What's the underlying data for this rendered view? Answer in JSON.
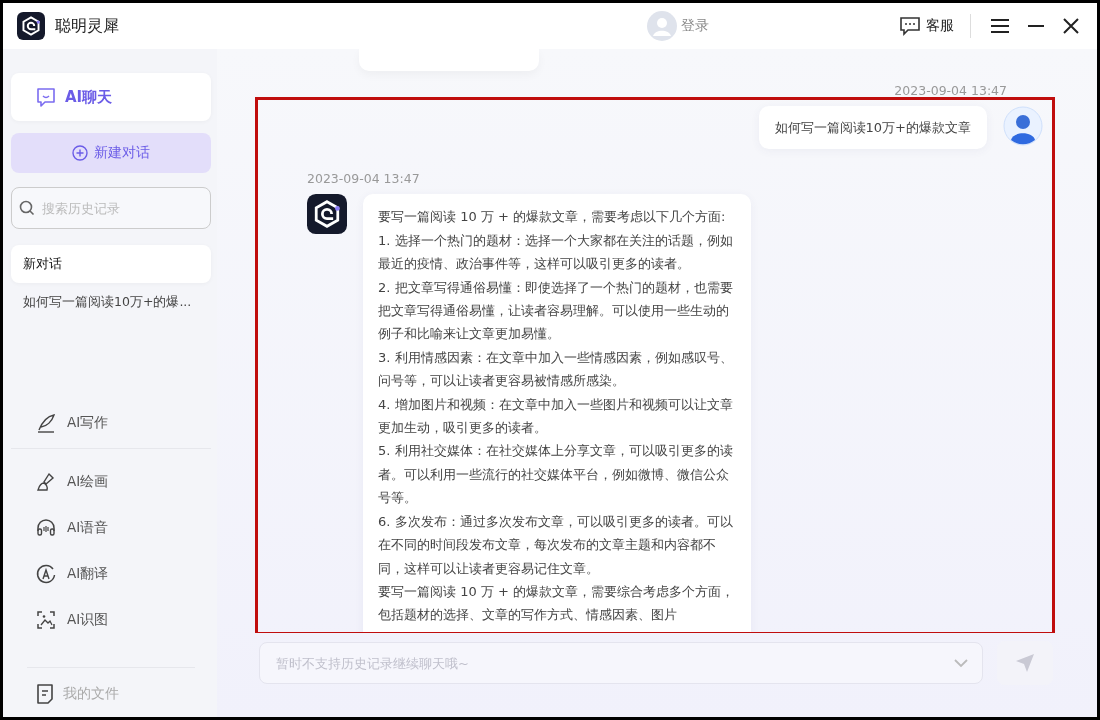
{
  "window": {
    "title": "聪明灵犀"
  },
  "header": {
    "login": "登录",
    "service": "客服"
  },
  "sidebar": {
    "main_tab": {
      "label": "AI聊天",
      "selected": true
    },
    "new_chat": "新建对话",
    "search": {
      "placeholder": "搜索历史记录"
    },
    "history": [
      {
        "label": "新对话",
        "selected": true
      },
      {
        "label": "如何写一篇阅读10万+的爆...",
        "selected": false
      }
    ],
    "tools": [
      {
        "label": "AI写作",
        "kind": "writing",
        "selected": false
      },
      {
        "label": "AI绘画",
        "kind": "painting",
        "selected": false
      },
      {
        "label": "AI语音",
        "kind": "voice",
        "selected": false
      },
      {
        "label": "AI翻译",
        "kind": "translation",
        "selected": false
      },
      {
        "label": "AI识图",
        "kind": "recognition",
        "selected": false
      }
    ],
    "files": "我的文件"
  },
  "chat": {
    "highlighted": true,
    "messages": [
      {
        "kind": "user",
        "time": "2023-09-04 13:47",
        "paragraphs": [
          "如何写一篇阅读10万+的爆款文章"
        ]
      },
      {
        "kind": "assistant",
        "time": "2023-09-04 13:47",
        "paragraphs": [
          "要写一篇阅读 10 万 + 的爆款文章，需要考虑以下几个方面:",
          "1. 选择一个热门的题材：选择一个大家都在关注的话题，例如最近的疫情、政治事件等，这样可以吸引更多的读者。",
          "2. 把文章写得通俗易懂：即使选择了一个热门的题材，也需要把文章写得通俗易懂，让读者容易理解。可以使用一些生动的例子和比喻来让文章更加易懂。",
          "3. 利用情感因素：在文章中加入一些情感因素，例如感叹号、问号等，可以让读者更容易被情感所感染。",
          "4. 增加图片和视频：在文章中加入一些图片和视频可以让文章更加生动，吸引更多的读者。",
          "5. 利用社交媒体：在社交媒体上分享文章，可以吸引更多的读者。可以利用一些流行的社交媒体平台，例如微博、微信公众号等。",
          "6. 多次发布：通过多次发布文章，可以吸引更多的读者。可以在不同的时间段发布文章，每次发布的文章主题和内容都不同，这样可以让读者更容易记住文章。",
          "要写一篇阅读 10 万 + 的爆款文章，需要综合考虑多个方面，包括题材的选择、文章的写作方式、情感因素、图片"
        ]
      }
    ]
  },
  "composer": {
    "placeholder": "暂时不支持历史记录继续聊天哦~",
    "disabled": true
  }
}
